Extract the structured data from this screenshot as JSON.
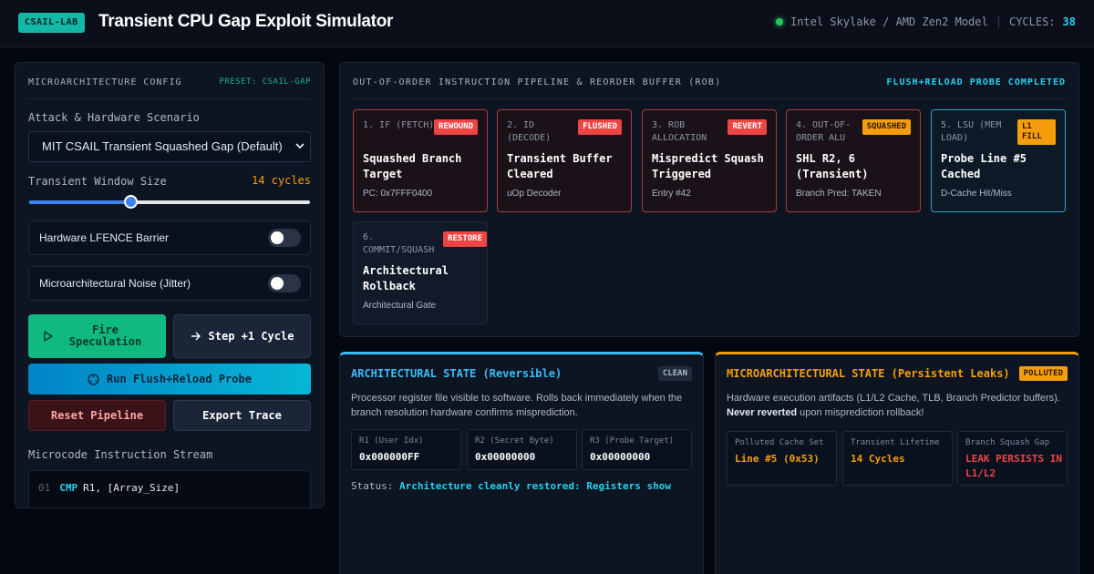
{
  "header": {
    "badge": "CSAIL-LAB",
    "title": "Transient CPU Gap Exploit Simulator",
    "model": "Intel Skylake / AMD Zen2 Model",
    "separator": "|",
    "cycles_label": "CYCLES:",
    "cycles_value": "38"
  },
  "config": {
    "title": "MICROARCHITECTURE CONFIG",
    "preset": "PRESET: CSAIL-GAP",
    "scenario_label": "Attack & Hardware Scenario",
    "scenario_value": "MIT CSAIL Transient Squashed Gap (Default)",
    "window_label": "Transient Window Size",
    "window_value": "14 cycles",
    "window_slider_fraction": 0.36,
    "toggles": [
      {
        "label": "Hardware LFENCE Barrier",
        "on": false
      },
      {
        "label": "Microarchitectural Noise (Jitter)",
        "on": false
      }
    ],
    "buttons": {
      "fire": "Fire Speculation",
      "step": "Step +1 Cycle",
      "flush": "Run Flush+Reload Probe",
      "reset": "Reset Pipeline",
      "export": "Export Trace"
    },
    "stream_label": "Microcode Instruction Stream",
    "stream": [
      {
        "num": "01",
        "op": "CMP",
        "args": "R1, [Array_Size]"
      }
    ]
  },
  "pipeline": {
    "title": "OUT-OF-ORDER INSTRUCTION PIPELINE & REORDER BUFFER (ROB)",
    "status": "FLUSH+RELOAD PROBE COMPLETED",
    "stages": [
      {
        "label": "1. IF (FETCH)",
        "badge": "REWOUND",
        "name": "Squashed Branch Target",
        "sub": "PC: 0x7FFF0400"
      },
      {
        "label": "2. ID (DECODE)",
        "badge": "FLUSHED",
        "name": "Transient Buffer Cleared",
        "sub": "uOp Decoder"
      },
      {
        "label": "3. ROB ALLOCATION",
        "badge": "REVERT",
        "name": "Mispredict Squash Triggered",
        "sub": "Entry #42"
      },
      {
        "label": "4. OUT-OF-ORDER ALU",
        "badge": "SQUASHED",
        "name": "SHL R2, 6 (Transient)",
        "sub": "Branch Pred: TAKEN"
      },
      {
        "label": "5. LSU (MEM LOAD)",
        "badge": "L1 FILL",
        "name": "Probe Line #5 Cached",
        "sub": "D-Cache Hit/Miss"
      },
      {
        "label": "6. COMMIT/SQUASH",
        "badge": "RESTORE",
        "name": "Architectural Rollback",
        "sub": "Architectural Gate"
      }
    ]
  },
  "arch_state": {
    "title": "ARCHITECTURAL STATE (Reversible)",
    "badge": "CLEAN",
    "desc": "Processor register file visible to software. Rolls back immediately when the branch resolution hardware confirms misprediction.",
    "registers": [
      {
        "label": "R1 (User Idx)",
        "value": "0x000000FF"
      },
      {
        "label": "R2 (Secret Byte)",
        "value": "0x00000000"
      },
      {
        "label": "R3 (Probe Target)",
        "value": "0x00000000"
      }
    ],
    "status_label": "Status:",
    "status_value": "Architecture cleanly restored: Registers show"
  },
  "micro_state": {
    "title": "MICROARCHITECTURAL STATE (Persistent Leaks)",
    "badge": "POLLUTED",
    "desc_start": "Hardware execution artifacts (L1/L2 Cache, TLB, Branch Predictor buffers).",
    "desc_bold": "Never reverted",
    "desc_end": "upon misprediction rollback!",
    "cells": [
      {
        "label": "Polluted Cache Set",
        "value": "Line #5 (0x53)"
      },
      {
        "label": "Transient Lifetime",
        "value": "14 Cycles"
      },
      {
        "label": "Branch Squash Gap",
        "value": "LEAK PERSISTS IN L1/L2"
      }
    ]
  },
  "colors": {
    "accent_cyan": "#22d3ee",
    "accent_green": "#10b981",
    "danger_red": "#ef4444",
    "warning_amber": "#f59e0b"
  }
}
